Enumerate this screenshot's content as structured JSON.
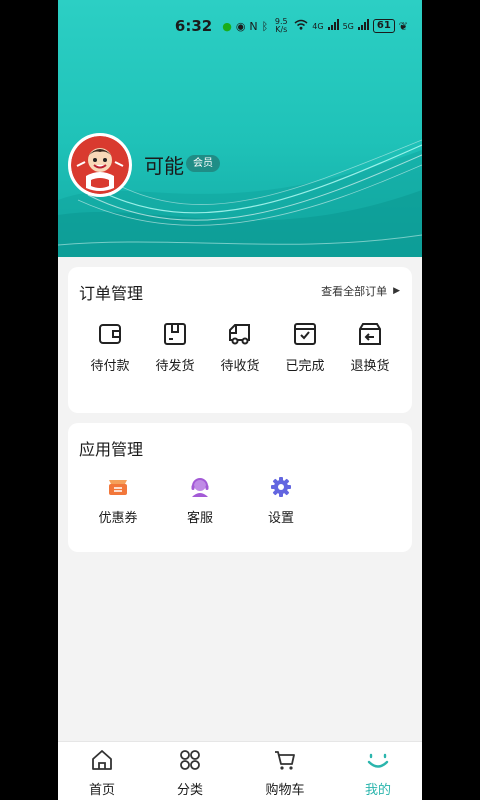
{
  "status_bar": {
    "time": "6:32",
    "network_speed": "9.5 K/s",
    "signal_1": "4G",
    "signal_2": "5G",
    "battery": "61"
  },
  "profile": {
    "name": "可能",
    "badge": "会员"
  },
  "orders": {
    "title": "订单管理",
    "view_all": "查看全部订单",
    "items": [
      {
        "label": "待付款",
        "icon": "wallet-icon"
      },
      {
        "label": "待发货",
        "icon": "package-icon"
      },
      {
        "label": "待收货",
        "icon": "truck-icon"
      },
      {
        "label": "已完成",
        "icon": "completed-icon"
      },
      {
        "label": "退换货",
        "icon": "return-icon"
      }
    ]
  },
  "apps": {
    "title": "应用管理",
    "items": [
      {
        "label": "优惠券",
        "icon": "coupon-icon",
        "color": "#f2773a"
      },
      {
        "label": "客服",
        "icon": "customer-service-icon",
        "color": "#a35ad6"
      },
      {
        "label": "设置",
        "icon": "settings-icon",
        "color": "#6366e0"
      }
    ]
  },
  "tabbar": {
    "items": [
      {
        "label": "首页",
        "icon": "home-icon"
      },
      {
        "label": "分类",
        "icon": "category-icon"
      },
      {
        "label": "购物车",
        "icon": "cart-icon"
      },
      {
        "label": "我的",
        "icon": "smile-icon",
        "active": true
      }
    ]
  },
  "colors": {
    "accent": "#2bb5ad",
    "header": "#1fc2b8",
    "background": "#f3f3f3"
  }
}
